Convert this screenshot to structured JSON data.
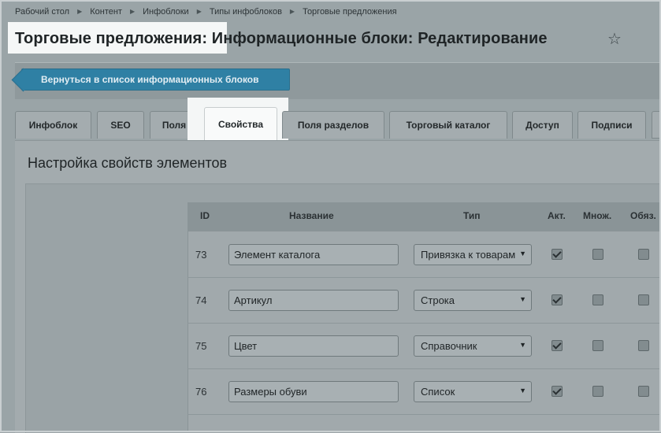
{
  "breadcrumb": [
    "Рабочий стол",
    "Контент",
    "Инфоблоки",
    "Типы инфоблоков",
    "Торговые предложения"
  ],
  "header": {
    "title_part1": "Торговые предложения:",
    "title_part2": " Информационные блоки: Редактирование",
    "star_icon": "star-icon"
  },
  "toolbar": {
    "back_label": "Вернуться в список информационных блоков"
  },
  "tabs": [
    "Инфоблок",
    "SEO",
    "Поля",
    "Свойства",
    "Поля разделов",
    "Торговый каталог",
    "Доступ",
    "Подписи"
  ],
  "active_tab": "Свойства",
  "section": {
    "title": "Настройка свойств элементов"
  },
  "table": {
    "headers": {
      "id": "ID",
      "name": "Название",
      "type": "Тип",
      "active": "Акт.",
      "multiple": "Множ.",
      "required": "Обяз."
    },
    "rows": [
      {
        "id": "73",
        "name": "Элемент каталога",
        "type": "Привязка к товарам",
        "active": true,
        "multiple": false,
        "required": false
      },
      {
        "id": "74",
        "name": "Артикул",
        "type": "Строка",
        "active": true,
        "multiple": false,
        "required": false
      },
      {
        "id": "75",
        "name": "Цвет",
        "type": "Справочник",
        "active": true,
        "multiple": false,
        "required": false
      },
      {
        "id": "76",
        "name": "Размеры обуви",
        "type": "Список",
        "active": true,
        "multiple": false,
        "required": false
      }
    ]
  },
  "colors": {
    "accent": "#2f80a4",
    "highlight": "#f5f7f7",
    "overlay": "#9aa4a7"
  }
}
